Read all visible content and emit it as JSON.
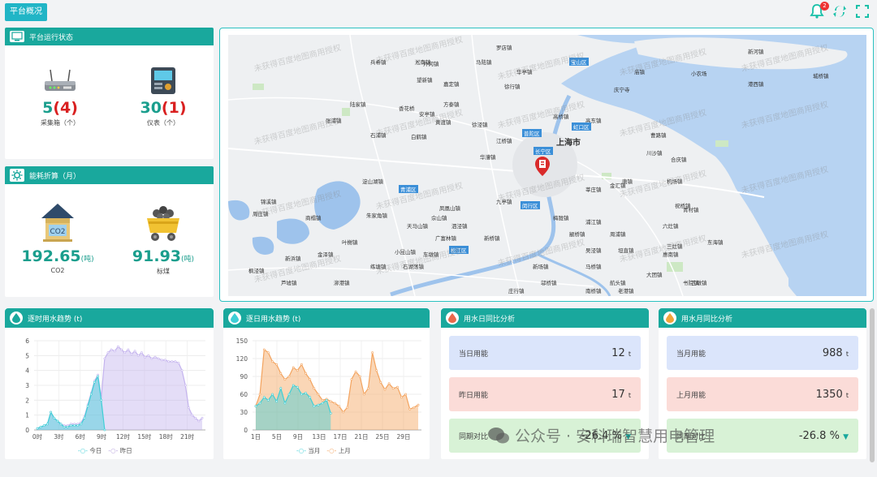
{
  "header": {
    "tab_label": "平台概况",
    "bell_count": "2"
  },
  "run_status": {
    "title": "平台运行状态",
    "collector": {
      "value": "5",
      "alert": "(4)",
      "label": "采集箱（个）"
    },
    "meter": {
      "value": "30",
      "alert": "(1)",
      "label": "仪表（个）"
    }
  },
  "energy": {
    "title": "能耗折算（月）",
    "co2": {
      "value": "192.65",
      "unit": "(吨)",
      "label": "CO2",
      "icon_text": "CO2"
    },
    "coal": {
      "value": "91.93",
      "unit": "(吨)",
      "label": "标煤"
    }
  },
  "map": {
    "watermark": "未获得百度地图商用授权",
    "city": "上海市",
    "places": [
      "罗店镇",
      "淞南镇",
      "马陆镇",
      "华亭镇",
      "徐行镇",
      "嘉定镇",
      "外冈镇",
      "望新镇",
      "兵希镇",
      "方泰镇",
      "安亭镇",
      "黄渡镇",
      "白鹤镇",
      "石浦镇",
      "陆家镇",
      "张浦镇",
      "香花桥",
      "徐泾镇",
      "江桥镇",
      "华漕镇",
      "九亭镇",
      "新桥镇",
      "泗泾镇",
      "佘山镇",
      "凤凰山镇",
      "天马山镇",
      "广富林镇",
      "车墩镇",
      "叶榭镇",
      "新浜镇",
      "枫泾镇",
      "泖港镇",
      "石湖荡镇",
      "小昆山镇",
      "淀山湖镇",
      "锦溪镇",
      "周庄镇",
      "商榻镇",
      "朱家角镇",
      "练塘镇",
      "金泽镇",
      "芦墟镇",
      "西小镇",
      "高桥镇",
      "高东镇",
      "庆宁寺",
      "川沙镇",
      "曹路镇",
      "合庆镇",
      "机场镇",
      "祝桥镇",
      "六灶镇",
      "唐镇",
      "惠南镇",
      "三灶镇",
      "大团镇",
      "书院镇",
      "东海镇",
      "新场镇",
      "航头镇",
      "周浦镇",
      "坦直镇",
      "三墩镇",
      "四团镇",
      "万祥镇",
      "老港镇",
      "庙镇",
      "小农场",
      "城桥镇",
      "港西镇",
      "新河镇",
      "浦江镇",
      "莘庄镇",
      "颛桥镇",
      "梅陇镇",
      "吴泾镇",
      "马桥镇",
      "邬桥镇",
      "奉城镇",
      "南桥镇",
      "西渡镇",
      "庄行镇",
      "柘林镇",
      "金汇镇",
      "青村镇",
      "四团镇",
      "平安镇",
      "松隐镇",
      "亭林镇",
      "廊下镇"
    ],
    "districts": [
      "宝山区",
      "普陀区",
      "长宁区",
      "虹口区",
      "闵行区",
      "青浦区",
      "松江区"
    ]
  },
  "charts_header": {
    "hourly_title": "逐时用水趋势 (t)",
    "daily_title": "逐日用水趋势 (t)",
    "day_cmp_title": "用水日同比分析",
    "month_cmp_title": "用水月同比分析"
  },
  "day_cmp": {
    "today_label": "当日用能",
    "today_value": "12",
    "today_unit": "t",
    "yesterday_label": "昨日用能",
    "yesterday_value": "17",
    "yesterday_unit": "t",
    "yoy_label": "同期对比",
    "yoy_value": "-26.4 %"
  },
  "month_cmp": {
    "cur_label": "当月用能",
    "cur_value": "988",
    "cur_unit": "t",
    "last_label": "上月用能",
    "last_value": "1350",
    "last_unit": "t",
    "yoy_label": "同期对比",
    "yoy_value": "-26.8 %"
  },
  "footer_watermark": "公众号 · 安科瑞智慧用电管理",
  "colors": {
    "teal": "#19a89d",
    "cyan": "#3ecfd6",
    "purple": "#c4b3ee",
    "orange": "#f3a35e"
  },
  "chart_data": [
    {
      "type": "area",
      "x_ticks": [
        "0时",
        "3时",
        "6时",
        "9时",
        "12时",
        "15时",
        "18时",
        "21时"
      ],
      "y_ticks": [
        "0",
        "1",
        "2",
        "3",
        "4",
        "5",
        "6"
      ],
      "ylim": [
        0,
        6
      ],
      "series": [
        {
          "name": "今日",
          "values": [
            0.1,
            0.2,
            0.3,
            0.4,
            1.2,
            0.8,
            0.6,
            0.4,
            0.2,
            0.2,
            0.3,
            0.3,
            0.3,
            0.4,
            0.8,
            1.6,
            2.4,
            3.2,
            3.6,
            2.0,
            0
          ]
        },
        {
          "name": "昨日",
          "values": [
            0.1,
            0.2,
            0.3,
            0.4,
            1.2,
            0.8,
            0.6,
            0.4,
            0.3,
            0.3,
            0.4,
            0.4,
            0.4,
            0.5,
            0.9,
            1.7,
            2.5,
            3.3,
            3.7,
            2.2,
            4.8,
            5.2,
            5.4,
            5.3,
            5.6,
            5.4,
            5.2,
            5.4,
            5.1,
            5.3,
            5.0,
            5.2,
            4.9,
            5.0,
            4.8,
            4.9,
            4.8,
            4.7,
            4.7,
            4.6,
            4.6,
            4.6,
            4.5,
            4.0,
            3.0,
            1.5,
            1.0,
            0.8,
            0.6,
            0.8
          ]
        }
      ]
    },
    {
      "type": "area",
      "x_ticks": [
        "1日",
        "5日",
        "9日",
        "13日",
        "17日",
        "21日",
        "25日",
        "29日"
      ],
      "y_ticks": [
        "0",
        "30",
        "60",
        "90",
        "120",
        "150"
      ],
      "ylim": [
        0,
        150
      ],
      "series": [
        {
          "name": "当月",
          "values": [
            40,
            45,
            55,
            50,
            60,
            48,
            70,
            45,
            60,
            75,
            72,
            60,
            62,
            55,
            40,
            42,
            45,
            50,
            28
          ]
        },
        {
          "name": "上月",
          "values": [
            40,
            60,
            135,
            130,
            115,
            110,
            95,
            85,
            90,
            105,
            100,
            110,
            95,
            85,
            70,
            60,
            50,
            52,
            48,
            45,
            40,
            30,
            38,
            85,
            98,
            90,
            60,
            70,
            130,
            100,
            80,
            68,
            78,
            70,
            72,
            55,
            60,
            35,
            38,
            42
          ]
        }
      ]
    }
  ]
}
